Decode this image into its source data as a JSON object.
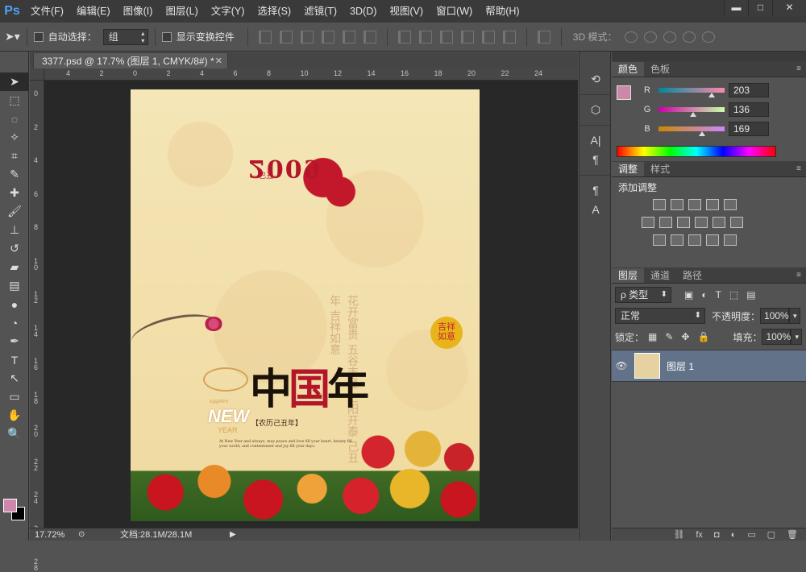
{
  "app": {
    "logo": "Ps"
  },
  "menu": [
    "文件(F)",
    "编辑(E)",
    "图像(I)",
    "图层(L)",
    "文字(Y)",
    "选择(S)",
    "滤镜(T)",
    "3D(D)",
    "视图(V)",
    "窗口(W)",
    "帮助(H)"
  ],
  "window_controls": {
    "minimize": "▬",
    "restore": "□",
    "close": "✕"
  },
  "options": {
    "auto_select_label": "自动选择：",
    "auto_select_value": "组",
    "show_transform_label": "显示变换控件",
    "mode3d_label": "3D 模式："
  },
  "document": {
    "tab_title": "3377.psd @ 17.7% (图层 1, CMYK/8#) *",
    "zoom": "17.72%",
    "doc_size": "文档:28.1M/28.1M",
    "h_ruler": [
      "4",
      "2",
      "0",
      "2",
      "4",
      "6",
      "8",
      "10",
      "12",
      "14",
      "16",
      "18",
      "20",
      "22",
      "24"
    ],
    "v_ruler": [
      "0",
      "2",
      "4",
      "6",
      "8",
      "1\n0",
      "1\n2",
      "1\n4",
      "1\n6",
      "1\n8",
      "2\n0",
      "2\n2",
      "2\n4",
      "2\n6",
      "2\n8"
    ]
  },
  "artwork": {
    "year_number": "2009",
    "year_mark": "—己丑—",
    "seal_text": "吉祥\n如意",
    "vertical_text": "花开富贵 五谷丰登 三阳开泰 己丑年 吉祥如意",
    "calligraphy_a": "中",
    "calligraphy_b": "国",
    "calligraphy_c": "年",
    "happy": "HAPPY",
    "new": "NEW",
    "year_small": "YEAR",
    "calendar_note": "【农历己丑年】",
    "blurb": "At New Year and always, may peace and love fill your heart, beauty fill your world, and contentment and joy fill your days."
  },
  "panels": {
    "color_tabs": [
      "颜色",
      "色板"
    ],
    "rgb": [
      {
        "label": "R",
        "value": "203",
        "fraction": 0.8,
        "gradient": "linear-gradient(90deg,#00889f,#ff88a9)"
      },
      {
        "label": "G",
        "value": "136",
        "fraction": 0.53,
        "gradient": "linear-gradient(90deg,#cb00a9,#cbffa9)"
      },
      {
        "label": "B",
        "value": "169",
        "fraction": 0.66,
        "gradient": "linear-gradient(90deg,#cb8800,#cb88ff)"
      }
    ],
    "fg_color": "#cb88a9",
    "adjust_tabs": [
      "调整",
      "样式"
    ],
    "adjust_title": "添加调整",
    "layers_tabs": [
      "图层",
      "通道",
      "路径"
    ],
    "kind_label": "ρ 类型",
    "blend_mode": "正常",
    "opacity_label": "不透明度：",
    "opacity_value": "100%",
    "lock_label": "锁定：",
    "fill_label": "填充：",
    "fill_value": "100%",
    "layer_name": "图层 1"
  }
}
